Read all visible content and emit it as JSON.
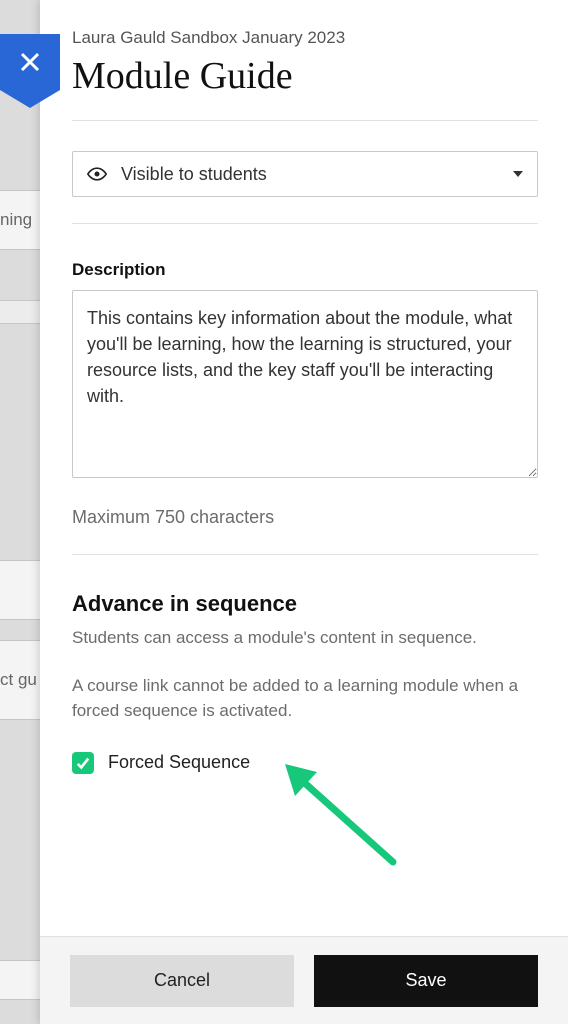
{
  "course_name": "Laura Gauld Sandbox January 2023",
  "page_title": "Module Guide",
  "visibility": {
    "selected_label": "Visible to students"
  },
  "description": {
    "label": "Description",
    "value": "This contains key information about the module, what you'll be learning, how the learning is structured, your resource lists, and the key staff you'll be interacting with.",
    "char_hint": "Maximum 750 characters"
  },
  "advance": {
    "heading": "Advance in sequence",
    "subtext": "Students can access a module's content in sequence.",
    "note": "A course link cannot be added to a learning module when a forced sequence is activated.",
    "checkbox_label": "Forced Sequence",
    "checked": true
  },
  "footer": {
    "cancel": "Cancel",
    "save": "Save"
  },
  "background": {
    "item1": "ning",
    "item2": "ct gu"
  },
  "colors": {
    "accent_blue": "#2a67d6",
    "accent_green": "#17c87b"
  }
}
